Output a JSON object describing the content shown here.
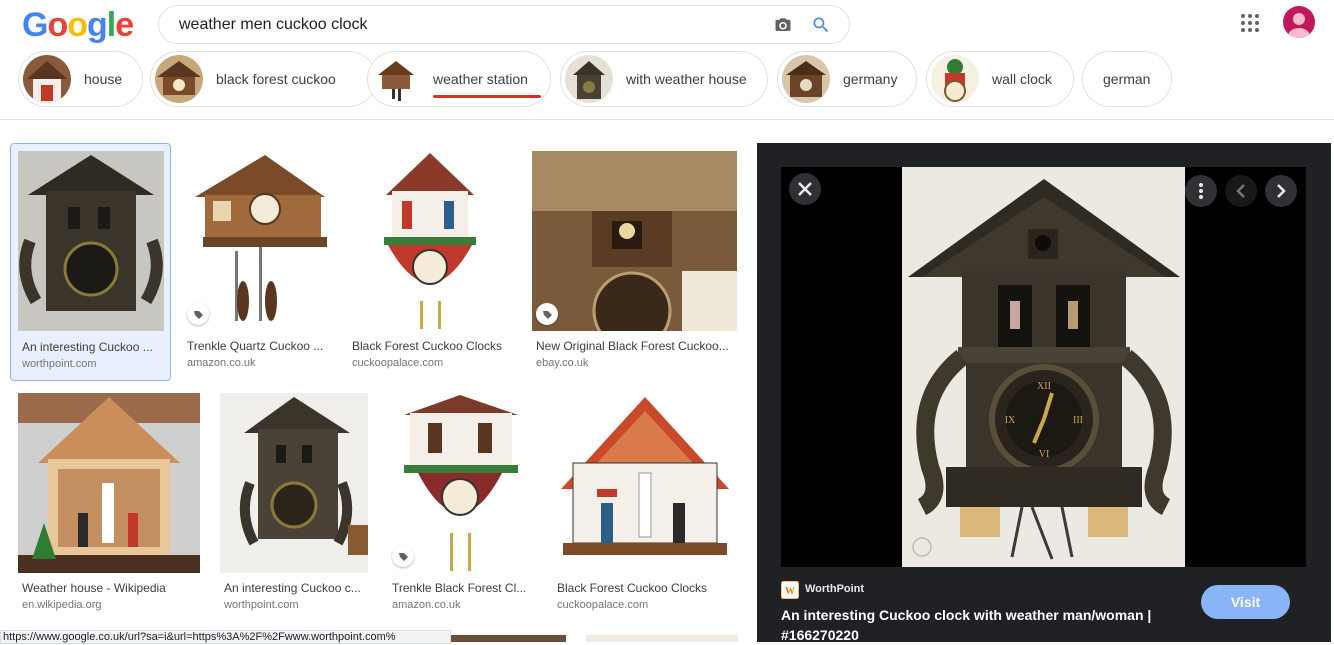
{
  "logo": {
    "letters": [
      "G",
      "o",
      "o",
      "g",
      "l",
      "e"
    ],
    "colors": [
      "#4285f4",
      "#ea4335",
      "#fbbc05",
      "#4285f4",
      "#34a853",
      "#ea4335"
    ]
  },
  "search": {
    "query": "weather men cuckoo clock",
    "camera_icon": "camera-icon",
    "search_icon": "search-icon"
  },
  "header": {
    "apps_icon": "apps-grid-icon",
    "avatar_icon": "account-avatar"
  },
  "chips": [
    {
      "label": "house"
    },
    {
      "label": "black forest cuckoo"
    },
    {
      "label": "weather station",
      "active": true
    },
    {
      "label": "with weather house"
    },
    {
      "label": "germany"
    },
    {
      "label": "wall clock"
    },
    {
      "label": "german"
    }
  ],
  "results": [
    {
      "title": "An interesting Cuckoo ...",
      "source": "worthpoint.com",
      "selected": true
    },
    {
      "title": "Trenkle Quartz Cuckoo ...",
      "source": "amazon.co.uk",
      "tag": true
    },
    {
      "title": "Black Forest Cuckoo Clocks",
      "source": "cuckoopalace.com"
    },
    {
      "title": "New Original Black Forest Cuckoo...",
      "source": "ebay.co.uk",
      "tag": true
    },
    {
      "title": "Weather house - Wikipedia",
      "source": "en.wikipedia.org"
    },
    {
      "title": "An interesting Cuckoo c...",
      "source": "worthpoint.com"
    },
    {
      "title": "Trenkle Black Forest Cl...",
      "source": "amazon.co.uk",
      "tag": true
    },
    {
      "title": "Black Forest Cuckoo Clocks",
      "source": "cuckoopalace.com"
    }
  ],
  "panel": {
    "source_name": "WorthPoint",
    "title": "An interesting Cuckoo clock with weather man/woman | #166270220",
    "visit_label": "Visit",
    "close_icon": "close-icon",
    "more_icon": "more-vert-icon",
    "prev_icon": "chevron-left-icon",
    "next_icon": "chevron-right-icon"
  },
  "status": {
    "url": "https://www.google.co.uk/url?sa=i&url=https%3A%2F%2Fwww.worthpoint.com%"
  }
}
